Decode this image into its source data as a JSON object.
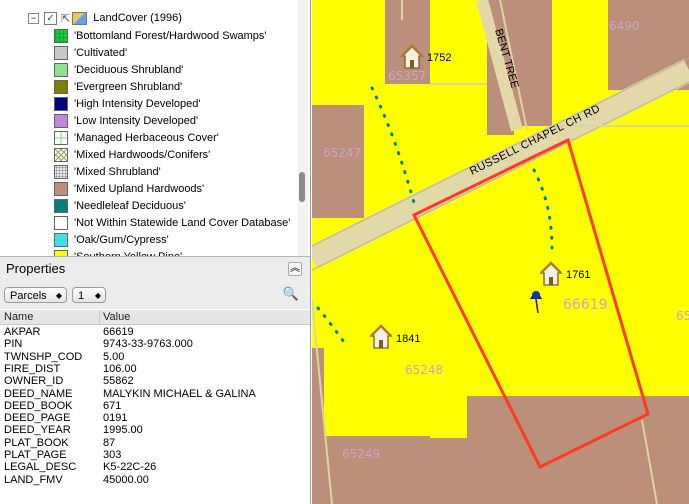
{
  "legend": {
    "layer_name": "LandCover (1996)",
    "items": [
      {
        "label": "'Bottomland Forest/Hardwood Swamps'",
        "color": "#22cc22",
        "pattern": "grid"
      },
      {
        "label": "'Cultivated'",
        "color": "#c8c8c8",
        "pattern": "solid"
      },
      {
        "label": "'Deciduous Shrubland'",
        "color": "#8fe08f",
        "pattern": "solid"
      },
      {
        "label": "'Evergreen Shrubland'",
        "color": "#808000",
        "pattern": "solid"
      },
      {
        "label": "'High Intensity Developed'",
        "color": "#000080",
        "pattern": "solid"
      },
      {
        "label": "'Low Intensity Developed'",
        "color": "#c088d8",
        "pattern": "solid"
      },
      {
        "label": "'Managed Herbaceous Cover'",
        "color": "#7cd87c",
        "pattern": "cross"
      },
      {
        "label": "'Mixed Hardwoods/Conifers'",
        "color": "#a0a060",
        "pattern": "diag"
      },
      {
        "label": "'Mixed Shrubland'",
        "color": "#c8c8c8",
        "pattern": "dots"
      },
      {
        "label": "'Mixed Upland Hardwoods'",
        "color": "#bc8f7a",
        "pattern": "solid"
      },
      {
        "label": "'Needleleaf Deciduous'",
        "color": "#008080",
        "pattern": "solid"
      },
      {
        "label": "'Not Within Statewide Land Cover Database'",
        "color": "#ffffff",
        "pattern": "solid"
      },
      {
        "label": "'Oak/Gum/Cypress'",
        "color": "#40e0e0",
        "pattern": "solid"
      },
      {
        "label": "'Southern Yellow Pine'",
        "color": "#ffff00",
        "pattern": "solid"
      }
    ]
  },
  "properties": {
    "title": "Properties",
    "layer_select": "Parcels",
    "index_select": "1",
    "columns": {
      "name": "Name",
      "value": "Value"
    },
    "rows": [
      {
        "name": "AKPAR",
        "value": "66619"
      },
      {
        "name": "PIN",
        "value": "9743-33-9763.000"
      },
      {
        "name": "TWNSHP_COD",
        "value": "5.00"
      },
      {
        "name": "FIRE_DIST",
        "value": "106.00"
      },
      {
        "name": "OWNER_ID",
        "value": "55862"
      },
      {
        "name": "DEED_NAME",
        "value": "MALYKIN MICHAEL & GALINA"
      },
      {
        "name": "DEED_BOOK",
        "value": "671"
      },
      {
        "name": "DEED_PAGE",
        "value": "0191"
      },
      {
        "name": "DEED_YEAR",
        "value": "1995.00"
      },
      {
        "name": "PLAT_BOOK",
        "value": "87"
      },
      {
        "name": "PLAT_PAGE",
        "value": "303"
      },
      {
        "name": "LEGAL_DESC",
        "value": "K5-22C-26"
      },
      {
        "name": "LAND_FMV",
        "value": "45000.00"
      }
    ]
  },
  "map": {
    "road_labels": {
      "main": "RUSSELL CHAPEL CH RD",
      "side": "BENT TREE"
    },
    "parcel_labels": {
      "p1": "6490",
      "p2": "65357",
      "p3": "65247",
      "p4": "66619",
      "p5": "65248",
      "p6": "65249",
      "p7": "65"
    },
    "address_labels": {
      "a1": "1752",
      "a2": "1761",
      "a3": "1841"
    },
    "colors": {
      "pine": "#ffff00",
      "hardwood": "#bc8f7a",
      "selection": "#ff3b1f",
      "dots": "#008080",
      "road": "#e2d9a8",
      "parcel_label": "#c9a6c6"
    }
  }
}
